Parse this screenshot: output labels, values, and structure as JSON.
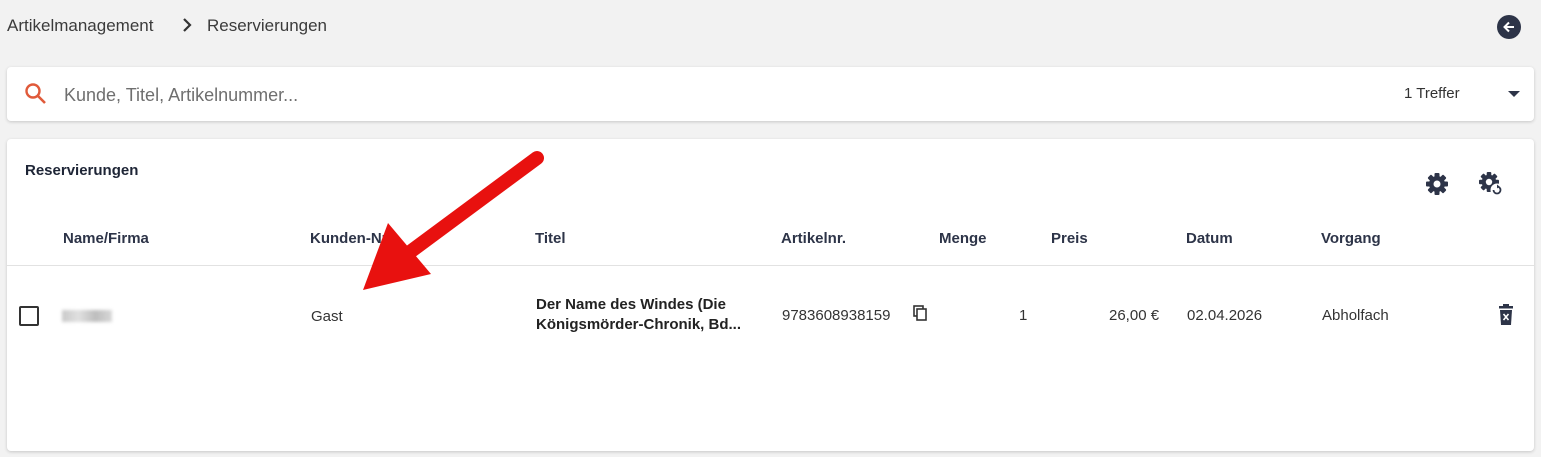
{
  "breadcrumb": {
    "item1": "Artikelmanagement",
    "item2": "Reservierungen"
  },
  "search": {
    "placeholder": "Kunde, Titel, Artikelnummer...",
    "hits": "1 Treffer"
  },
  "table": {
    "title": "Reservierungen",
    "headers": {
      "name": "Name/Firma",
      "kundennr": "Kunden-Nr",
      "titel": "Titel",
      "artikelnr": "Artikelnr.",
      "menge": "Menge",
      "preis": "Preis",
      "datum": "Datum",
      "vorgang": "Vorgang"
    },
    "rows": [
      {
        "kundennr": "Gast",
        "titel_line1": "Der Name des Windes (Die",
        "titel_line2": "Königsmörder-Chronik, Bd...",
        "artikelnr": "9783608938159",
        "menge": "1",
        "preis": "26,00 €",
        "datum": "02.04.2026",
        "vorgang": "Abholfach"
      }
    ]
  },
  "colors": {
    "accent_search": "#e05a3a",
    "dark": "#2d3448",
    "annotation_arrow": "#e8110f"
  },
  "icons": {
    "back": "arrow-left-circle-icon",
    "search": "search-icon",
    "dropdown": "caret-down-icon",
    "settings": "gear-icon",
    "settings_refresh": "gear-refresh-icon",
    "copy": "copy-icon",
    "delete": "trash-icon"
  }
}
